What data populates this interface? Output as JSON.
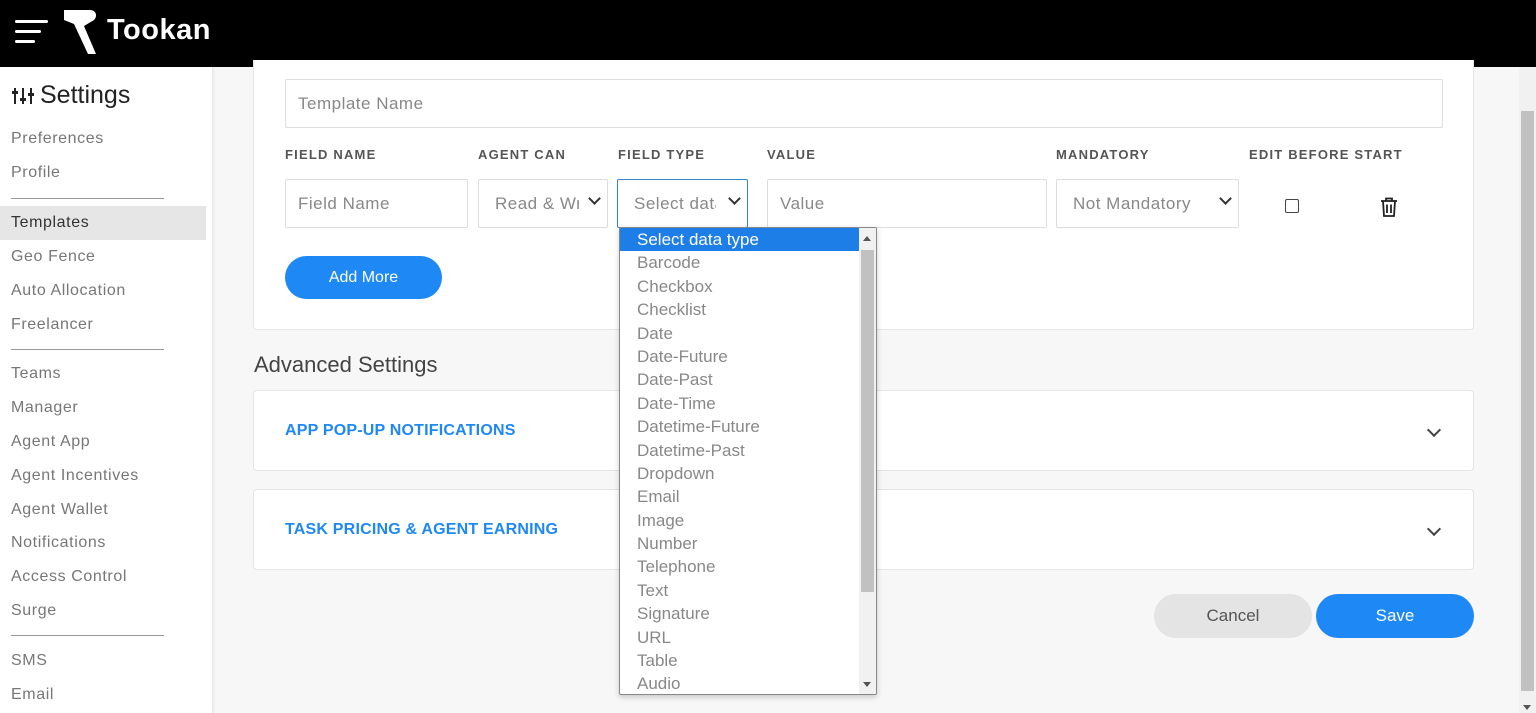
{
  "header": {
    "brand": "Tookan"
  },
  "sidebar": {
    "title": "Settings",
    "groups": [
      [
        "Preferences",
        "Profile"
      ],
      [
        "Templates",
        "Geo Fence",
        "Auto Allocation",
        "Freelancer"
      ],
      [
        "Teams",
        "Manager",
        "Agent  App",
        "Agent  Incentives",
        "Agent Wallet",
        "Notifications",
        "Access Control",
        "Surge"
      ],
      [
        "SMS",
        "Email"
      ]
    ],
    "active": "Templates"
  },
  "form": {
    "template_name_placeholder": "Template Name",
    "columns": [
      "FIELD NAME",
      "AGENT CAN",
      "FIELD TYPE",
      "VALUE",
      "MANDATORY",
      "EDIT BEFORE START"
    ],
    "row": {
      "field_name_placeholder": "Field Name",
      "agent_can": "Read & Write",
      "field_type": "Select data type",
      "value_placeholder": "Value",
      "mandatory": "Not Mandatory",
      "edit_before_start": false
    },
    "add_more_label": "Add More"
  },
  "advanced": {
    "title": "Advanced Settings",
    "sections": [
      "APP POP-UP NOTIFICATIONS",
      "TASK PRICING & AGENT EARNING"
    ]
  },
  "actions": {
    "cancel": "Cancel",
    "save": "Save"
  },
  "field_type_options": {
    "selected": "Select data type",
    "options": [
      "Select data type",
      "Barcode",
      "Checkbox",
      "Checklist",
      "Date",
      "Date-Future",
      "Date-Past",
      "Date-Time",
      "Datetime-Future",
      "Datetime-Past",
      "Dropdown",
      "Email",
      "Image",
      "Number",
      "Telephone",
      "Text",
      "Signature",
      "URL",
      "Table",
      "Audio"
    ]
  },
  "colors": {
    "accent": "#1e88f5",
    "topbar": "#000000",
    "selected_option": "#1e7ee8"
  }
}
